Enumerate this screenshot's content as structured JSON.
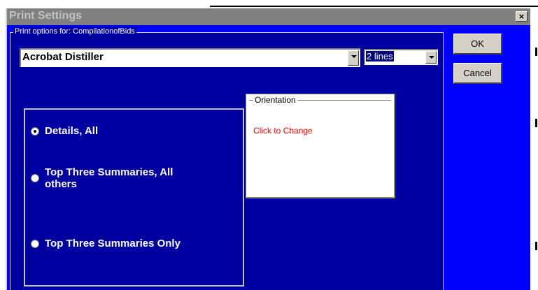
{
  "window": {
    "title": "Print Settings",
    "close_glyph": "×"
  },
  "print_options": {
    "group_label": "Print options for: CompilationofBids",
    "printer_value": "Acrobat Distiller",
    "lines_value": "2 lines"
  },
  "radio_group": {
    "options": [
      {
        "label": "Details, All",
        "selected": true
      },
      {
        "label": "Top Three Summaries, All others",
        "line1": "Top Three Summaries, All",
        "line2": "others",
        "selected": false
      },
      {
        "label": "Top Three Summaries Only",
        "selected": false
      }
    ]
  },
  "orientation": {
    "label": "Orientation",
    "action": "Click to Change"
  },
  "buttons": {
    "ok": "OK",
    "cancel": "Cancel"
  }
}
